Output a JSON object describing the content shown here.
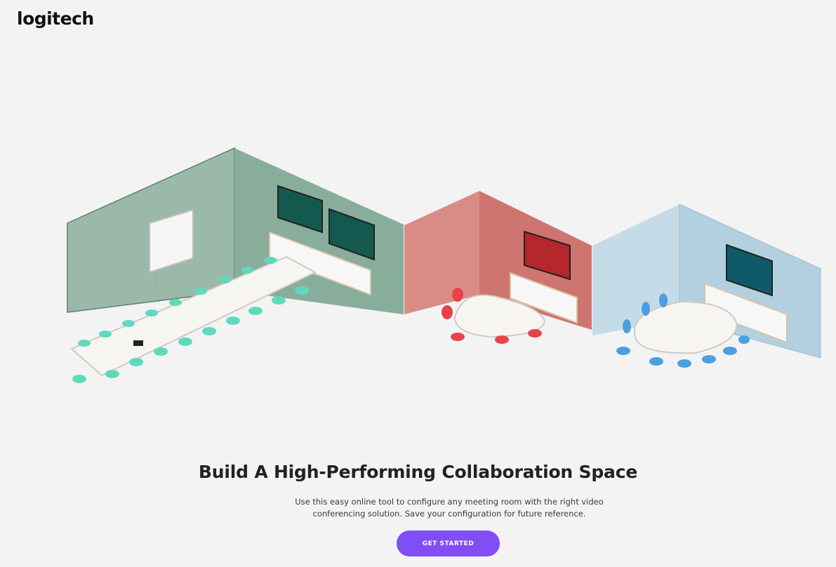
{
  "brand": {
    "logo_text": "logitech"
  },
  "hero": {
    "title": "Build A High-Performing Collaboration Space",
    "subtitle_line1": "Use this easy online tool to configure any meeting room with the right video",
    "subtitle_line2": "conferencing solution. Save your configuration for future reference.",
    "cta_label": "GET STARTED"
  },
  "rooms": [
    {
      "name": "large-room",
      "wall_color": "#8fb3a2",
      "chair_color": "#5fd9bd"
    },
    {
      "name": "medium-room",
      "wall_color": "#d9807a",
      "chair_color": "#e8434a"
    },
    {
      "name": "small-room",
      "wall_color": "#bcd6e4",
      "chair_color": "#4a9fe0"
    }
  ],
  "colors": {
    "accent": "#814ef5",
    "background": "#f3f3f3"
  }
}
